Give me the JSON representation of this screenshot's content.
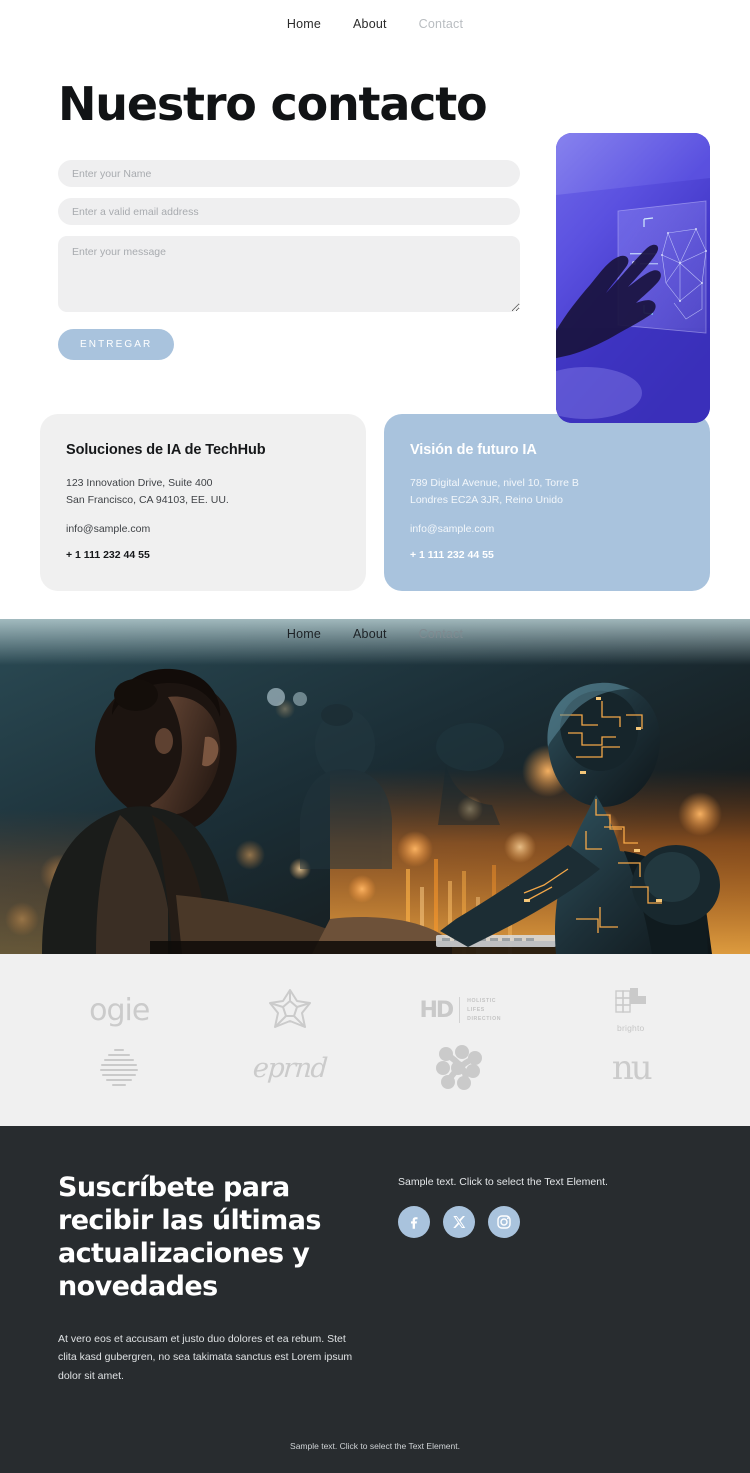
{
  "nav_primary": {
    "items": [
      {
        "label": "Home",
        "state": "normal"
      },
      {
        "label": "About",
        "state": "normal"
      },
      {
        "label": "Contact",
        "state": "muted"
      }
    ]
  },
  "nav_banner": {
    "items": [
      {
        "label": "Home",
        "state": "normal"
      },
      {
        "label": "About",
        "state": "normal"
      },
      {
        "label": "Contact",
        "state": "muted"
      }
    ]
  },
  "contact": {
    "title": "Nuestro contacto",
    "form": {
      "name_placeholder": "Enter your Name",
      "name_value": "",
      "email_placeholder": "Enter a valid email address",
      "email_value": "",
      "message_placeholder": "Enter your message",
      "message_value": "",
      "submit_label": "ENTREGAR",
      "submit_color": "#a9c3dd",
      "field_background": "#efeff0"
    },
    "photo": {
      "alt": "Hand touching a translucent holographic touchscreen",
      "tint": "#4238c8"
    }
  },
  "cards": [
    {
      "title": "Soluciones de IA de TechHub",
      "address_line1": "123 Innovation Drive, Suite 400",
      "address_line2": "San Francisco, CA 94103, EE. UU.",
      "email": "info@sample.com",
      "phone": "+ 1 111 232 44 55",
      "background": "#f0f0f0",
      "theme": "light"
    },
    {
      "title": "Visión de futuro IA",
      "address_line1": "789 Digital Avenue, nivel 10, Torre B",
      "address_line2": "Londres EC2A 3JR, Reino Unido",
      "email": "info@sample.com",
      "phone": "+ 1 111 232 44 55",
      "background": "#a9c3dd",
      "theme": "blue"
    }
  ],
  "banner": {
    "alt": "Woman working at a desk beside a glowing humanoid robot with orange circuitry",
    "background": "#131a20"
  },
  "logo_strip": {
    "background": "#f0f0f0",
    "logos": [
      {
        "name": "ogie",
        "text": "ogie",
        "kind": "wordmark"
      },
      {
        "name": "flower-star",
        "text": "",
        "kind": "mark"
      },
      {
        "name": "holistic-lifes-direction",
        "text": "HD",
        "line1": "HOLISTIC",
        "line2": "LIFES",
        "line3": "DIRECTION",
        "kind": "lockup"
      },
      {
        "name": "brighto",
        "text": "brighto",
        "kind": "lockup"
      },
      {
        "name": "striped-sphere",
        "text": "",
        "kind": "mark"
      },
      {
        "name": "eprnd",
        "text": "eprnd",
        "kind": "wordmark"
      },
      {
        "name": "dot-swirl",
        "text": "",
        "kind": "mark"
      },
      {
        "name": "nu",
        "text": "nu",
        "kind": "wordmark"
      }
    ]
  },
  "footer": {
    "background": "#282c2f",
    "heading": "Suscríbete para recibir las últimas actualizaciones y novedades",
    "body": "At vero eos et accusam et justo duo dolores et ea rebum. Stet clita kasd gubergren, no sea takimata sanctus est Lorem ipsum dolor sit amet.",
    "sample_text": "Sample text. Click to select the Text Element.",
    "socials": [
      {
        "name": "facebook",
        "label": "Facebook"
      },
      {
        "name": "x-twitter",
        "label": "X"
      },
      {
        "name": "instagram",
        "label": "Instagram"
      }
    ],
    "social_color": "#a9c3dd",
    "bottom_text": "Sample text. Click to select the Text Element."
  }
}
